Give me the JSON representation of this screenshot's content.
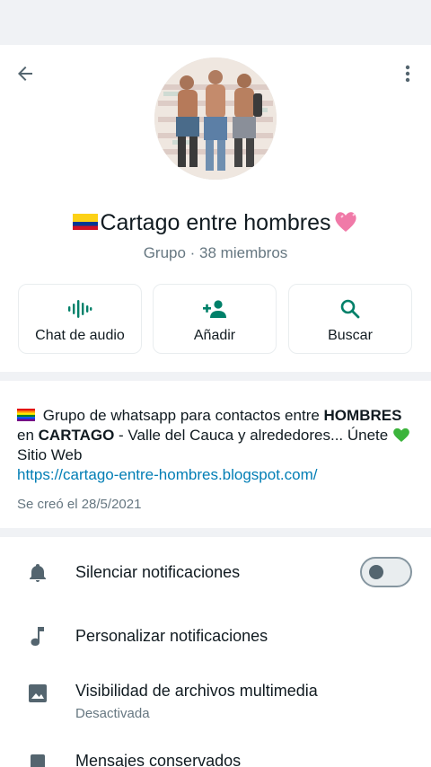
{
  "group": {
    "title": "Cartago entre hombres",
    "subtitle": "Grupo · 38 miembros"
  },
  "actions": [
    {
      "label": "Chat de audio",
      "icon": "audio-wave-icon"
    },
    {
      "label": "Añadir",
      "icon": "add-person-icon"
    },
    {
      "label": "Buscar",
      "icon": "search-icon"
    }
  ],
  "description": {
    "part1": " Grupo de whatsapp para contactos entre ",
    "bold1": "HOMBRES",
    "part2": " en ",
    "bold2": "CARTAGO",
    "part3": " - Valle del Cauca y alrededores... Únete ",
    "part4": "  Sitio Web ",
    "link": "https://cartago-entre-hombres.blogspot.com/",
    "created": "Se creó el 28/5/2021"
  },
  "settings": {
    "mute": {
      "label": "Silenciar notificaciones",
      "enabled": false
    },
    "custom": {
      "label": "Personalizar notificaciones"
    },
    "media": {
      "label": "Visibilidad de archivos multimedia",
      "sub": "Desactivada"
    },
    "kept": {
      "label": "Mensajes conservados"
    }
  },
  "colors": {
    "accent": "#008069",
    "link": "#027eb5",
    "icon_gray": "#54656f"
  }
}
